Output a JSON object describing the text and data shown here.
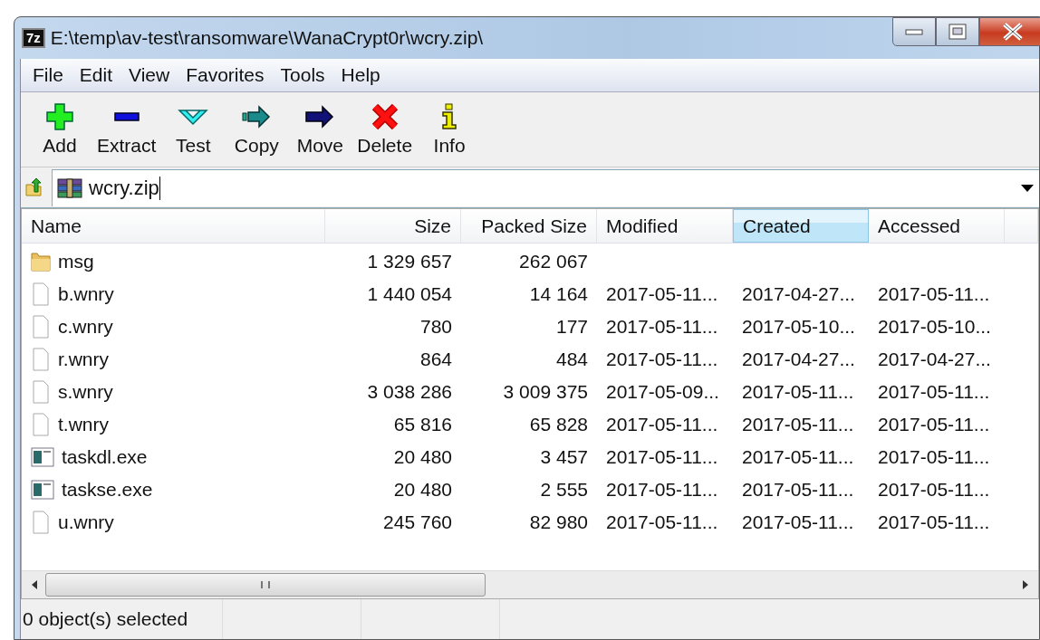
{
  "window": {
    "app_icon": "7z",
    "title": "E:\\temp\\av-test\\ransomware\\WanaCrypt0r\\wcry.zip\\"
  },
  "menu": [
    "File",
    "Edit",
    "View",
    "Favorites",
    "Tools",
    "Help"
  ],
  "toolbar": [
    {
      "kind": "add",
      "label": "Add"
    },
    {
      "kind": "extract",
      "label": "Extract"
    },
    {
      "kind": "test",
      "label": "Test"
    },
    {
      "kind": "copy",
      "label": "Copy"
    },
    {
      "kind": "move",
      "label": "Move"
    },
    {
      "kind": "delete",
      "label": "Delete"
    },
    {
      "kind": "info",
      "label": "Info"
    }
  ],
  "address": {
    "value": "wcry.zip"
  },
  "table": {
    "columns": [
      {
        "label": "Name",
        "selected": false
      },
      {
        "label": "Size",
        "selected": false
      },
      {
        "label": "Packed Size",
        "selected": false
      },
      {
        "label": "Modified",
        "selected": false
      },
      {
        "label": "Created",
        "selected": true
      },
      {
        "label": "Accessed",
        "selected": false
      }
    ],
    "rows": [
      {
        "kind": "folder",
        "cells": [
          "msg",
          "1 329 657",
          "262 067",
          "",
          "",
          ""
        ]
      },
      {
        "kind": "file",
        "cells": [
          "b.wnry",
          "1 440 054",
          "14 164",
          "2017-05-11...",
          "2017-04-27...",
          "2017-05-11..."
        ]
      },
      {
        "kind": "file",
        "cells": [
          "c.wnry",
          "780",
          "177",
          "2017-05-11...",
          "2017-05-10...",
          "2017-05-10..."
        ]
      },
      {
        "kind": "file",
        "cells": [
          "r.wnry",
          "864",
          "484",
          "2017-05-11...",
          "2017-04-27...",
          "2017-04-27..."
        ]
      },
      {
        "kind": "file",
        "cells": [
          "s.wnry",
          "3 038 286",
          "3 009 375",
          "2017-05-09...",
          "2017-05-11...",
          "2017-05-11..."
        ]
      },
      {
        "kind": "file",
        "cells": [
          "t.wnry",
          "65 816",
          "65 828",
          "2017-05-11...",
          "2017-05-11...",
          "2017-05-11..."
        ]
      },
      {
        "kind": "exe",
        "cells": [
          "taskdl.exe",
          "20 480",
          "3 457",
          "2017-05-11...",
          "2017-05-11...",
          "2017-05-11..."
        ]
      },
      {
        "kind": "exe",
        "cells": [
          "taskse.exe",
          "20 480",
          "2 555",
          "2017-05-11...",
          "2017-05-11...",
          "2017-05-11..."
        ]
      },
      {
        "kind": "file",
        "cells": [
          "u.wnry",
          "245 760",
          "82 980",
          "2017-05-11...",
          "2017-05-11...",
          "2017-05-11..."
        ]
      }
    ]
  },
  "status_bar": [
    "0 object(s) selected"
  ]
}
